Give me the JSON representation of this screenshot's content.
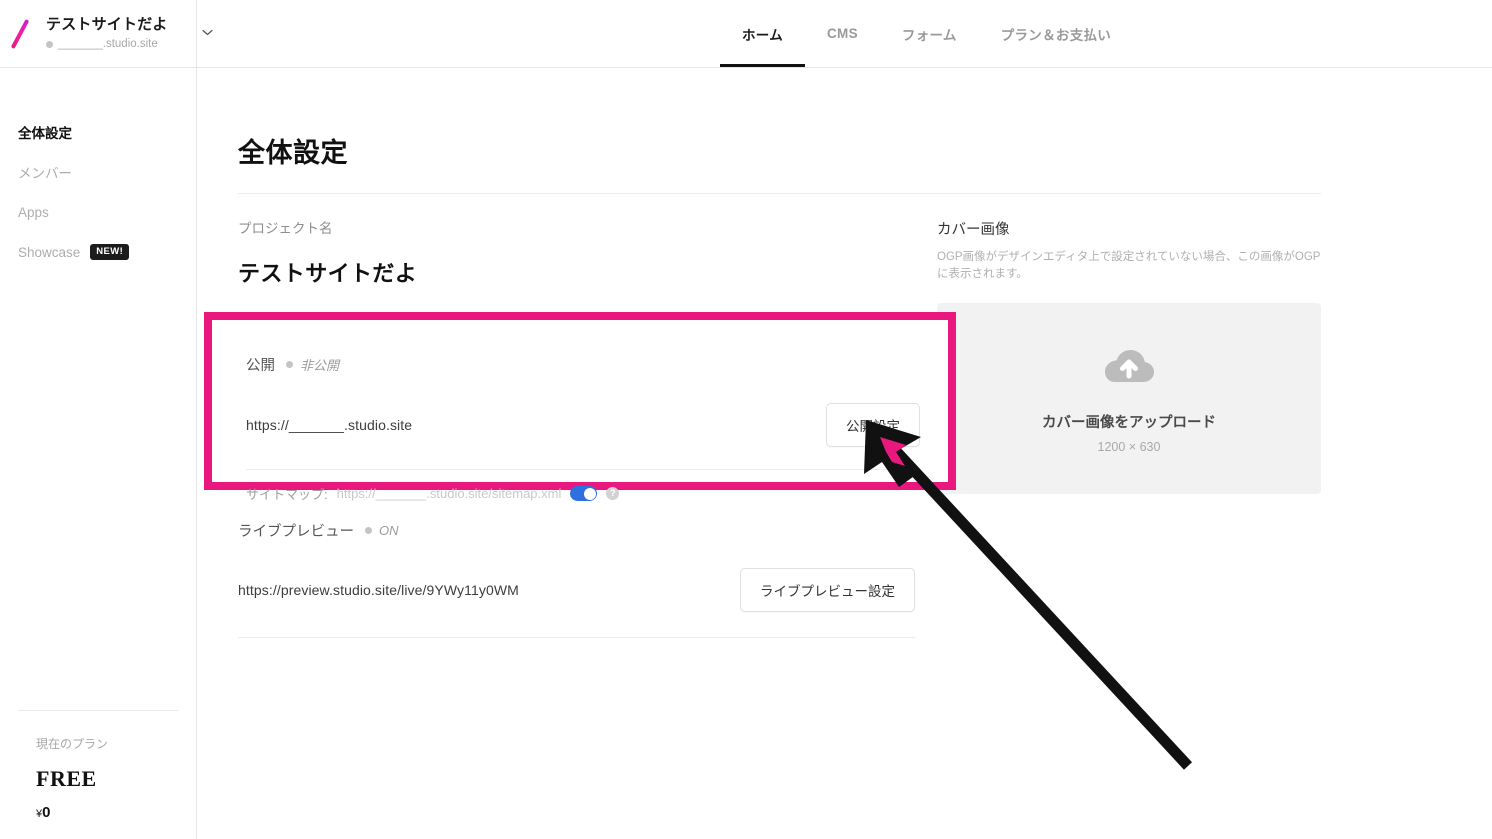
{
  "header": {
    "logo_icon": "studio-slash-logo",
    "project_title": "テストサイトだよ",
    "project_subdomain": "_______.studio.site",
    "dropdown_icon": "chevron-down-icon",
    "tabs": [
      {
        "label": "ホーム",
        "active": true
      },
      {
        "label": "CMS",
        "active": false
      },
      {
        "label": "フォーム",
        "active": false
      },
      {
        "label": "プラン＆お支払い",
        "active": false
      }
    ]
  },
  "sidebar": {
    "items": [
      {
        "label": "全体設定",
        "active": true,
        "badge": ""
      },
      {
        "label": "メンバー",
        "active": false,
        "badge": ""
      },
      {
        "label": "Apps",
        "active": false,
        "badge": ""
      },
      {
        "label": "Showcase",
        "active": false,
        "badge": "NEW!"
      }
    ],
    "plan": {
      "label": "現在のプラン",
      "name": "FREE",
      "currency": "¥",
      "price": "0"
    }
  },
  "main": {
    "page_title": "全体設定",
    "project_name_section": {
      "label": "プロジェクト名",
      "value": "テストサイトだよ",
      "edit_icon": "pencil-icon"
    },
    "publish_section": {
      "label": "公開",
      "status": "非公開",
      "status_dot_color": "#c4c4c4",
      "url": "https://_______.studio.site",
      "settings_button": "公開設定",
      "sitemap_label": "サイトマップ:",
      "sitemap_url": "https://_______.studio.site/sitemap.xml",
      "sitemap_toggle_on": true,
      "sitemap_toggle_color": "#2f6fe0",
      "help_icon": "question-mark-icon"
    },
    "live_preview_section": {
      "label": "ライブプレビュー",
      "status": "ON",
      "url": "https://preview.studio.site/live/9YWy11y0WM",
      "settings_button": "ライブプレビュー設定"
    },
    "cover_image_section": {
      "title": "カバー画像",
      "description": "OGP画像がデザインエディタ上で設定されていない場合、この画像がOGPに表示されます。",
      "upload_icon": "cloud-upload-icon",
      "upload_label": "カバー画像をアップロード",
      "dimensions": "1200 × 630"
    }
  },
  "annotations": {
    "highlight_box_color": "#e8187f",
    "highlight_target": "publish-section",
    "arrow_color": "#111111",
    "arrow_fill_color": "#e8187f",
    "arrow_points_to": "公開設定"
  }
}
